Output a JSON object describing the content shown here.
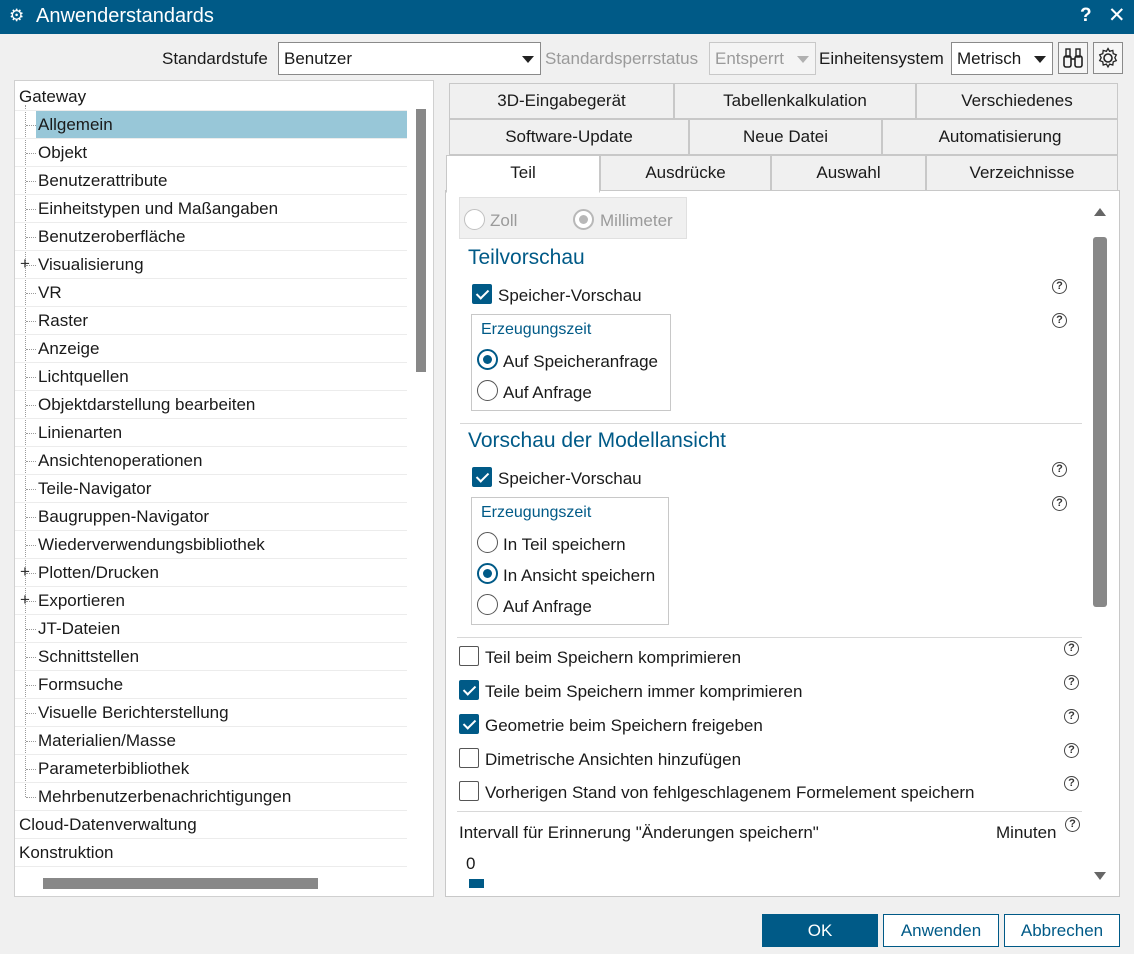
{
  "window": {
    "title": "Anwenderstandards",
    "help_label": "?",
    "close_label": "✕",
    "app_icon": "⚙"
  },
  "toolbar": {
    "standardstufe_label": "Standardstufe",
    "standardstufe_value": "Benutzer",
    "sperrstatus_label": "Standardsperrstatus",
    "sperrstatus_value": "Entsperrt",
    "einheiten_label": "Einheitensystem",
    "einheiten_value": "Metrisch",
    "binoculars_icon": "binoculars-icon",
    "settings_icon": "gear-icon"
  },
  "tree": {
    "items": [
      {
        "label": "Gateway",
        "level": 0,
        "expander": false
      },
      {
        "label": "Allgemein",
        "level": 1,
        "expander": false,
        "selected": true
      },
      {
        "label": "Objekt",
        "level": 1,
        "expander": false
      },
      {
        "label": "Benutzerattribute",
        "level": 1,
        "expander": false
      },
      {
        "label": "Einheitstypen und Maßangaben",
        "level": 1,
        "expander": false
      },
      {
        "label": "Benutzeroberfläche",
        "level": 1,
        "expander": false
      },
      {
        "label": "Visualisierung",
        "level": 1,
        "expander": true
      },
      {
        "label": "VR",
        "level": 1,
        "expander": false
      },
      {
        "label": "Raster",
        "level": 1,
        "expander": false
      },
      {
        "label": "Anzeige",
        "level": 1,
        "expander": false
      },
      {
        "label": "Lichtquellen",
        "level": 1,
        "expander": false
      },
      {
        "label": "Objektdarstellung bearbeiten",
        "level": 1,
        "expander": false
      },
      {
        "label": "Linienarten",
        "level": 1,
        "expander": false
      },
      {
        "label": "Ansichtenoperationen",
        "level": 1,
        "expander": false
      },
      {
        "label": "Teile-Navigator",
        "level": 1,
        "expander": false
      },
      {
        "label": "Baugruppen-Navigator",
        "level": 1,
        "expander": false
      },
      {
        "label": "Wiederverwendungsbibliothek",
        "level": 1,
        "expander": false
      },
      {
        "label": "Plotten/Drucken",
        "level": 1,
        "expander": true
      },
      {
        "label": "Exportieren",
        "level": 1,
        "expander": true
      },
      {
        "label": "JT-Dateien",
        "level": 1,
        "expander": false
      },
      {
        "label": "Schnittstellen",
        "level": 1,
        "expander": false
      },
      {
        "label": "Formsuche",
        "level": 1,
        "expander": false
      },
      {
        "label": "Visuelle Berichterstellung",
        "level": 1,
        "expander": false
      },
      {
        "label": "Materialien/Masse",
        "level": 1,
        "expander": false
      },
      {
        "label": "Parameterbibliothek",
        "level": 1,
        "expander": false
      },
      {
        "label": "Mehrbenutzerbenachrichtigungen",
        "level": 1,
        "expander": false
      },
      {
        "label": "Cloud-Datenverwaltung",
        "level": 0,
        "expander": false
      },
      {
        "label": "Konstruktion",
        "level": 0,
        "expander": false
      }
    ]
  },
  "tabs": {
    "row1": [
      "3D-Eingabegerät",
      "Tabellenkalkulation",
      "Verschiedenes"
    ],
    "row2": [
      "Software-Update",
      "Neue Datei",
      "Automatisierung"
    ],
    "row3": [
      "Teil",
      "Ausdrücke",
      "Auswahl",
      "Verzeichnisse"
    ],
    "active": "Teil"
  },
  "content": {
    "units": {
      "zoll": "Zoll",
      "millimeter": "Millimeter",
      "selected": "Millimeter"
    },
    "teilvorschau": {
      "title": "Teilvorschau",
      "speicher_vorschau": "Speicher-Vorschau",
      "speicher_checked": true,
      "group_title": "Erzeugungszeit",
      "options": [
        "Auf Speicheranfrage",
        "Auf Anfrage"
      ],
      "selected": "Auf Speicheranfrage"
    },
    "modellansicht": {
      "title": "Vorschau der Modellansicht",
      "speicher_vorschau": "Speicher-Vorschau",
      "speicher_checked": true,
      "group_title": "Erzeugungszeit",
      "options": [
        "In Teil speichern",
        "In Ansicht speichern",
        "Auf Anfrage"
      ],
      "selected": "In Ansicht speichern"
    },
    "checks": [
      {
        "label": "Teil beim Speichern komprimieren",
        "checked": false
      },
      {
        "label": "Teile beim Speichern immer komprimieren",
        "checked": true
      },
      {
        "label": "Geometrie beim Speichern freigeben",
        "checked": true
      },
      {
        "label": "Dimetrische Ansichten hinzufügen",
        "checked": false
      },
      {
        "label": "Vorherigen Stand von fehlgeschlagenem Formelement speichern",
        "checked": false
      }
    ],
    "interval_label": "Intervall für Erinnerung \"Änderungen speichern\"",
    "interval_unit": "Minuten",
    "interval_value": "0",
    "help_glyph": "?"
  },
  "buttons": {
    "ok": "OK",
    "apply": "Anwenden",
    "cancel": "Abbrechen"
  },
  "colors": {
    "accent": "#005a87",
    "selection": "#98c7d8"
  }
}
